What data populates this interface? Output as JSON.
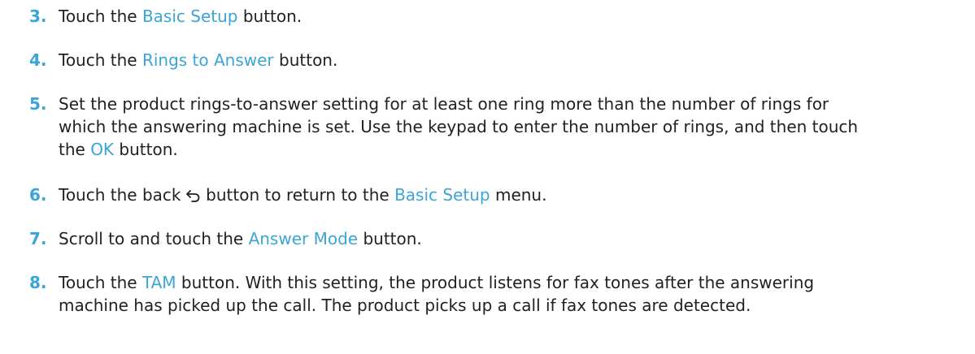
{
  "colors": {
    "accent": "#3aa5d6",
    "text": "#231f20"
  },
  "steps": [
    {
      "number": "3.",
      "parts": [
        "Touch the ",
        "Basic Setup",
        " button."
      ]
    },
    {
      "number": "4.",
      "parts": [
        "Touch the ",
        "Rings to Answer",
        " button."
      ]
    },
    {
      "number": "5.",
      "lines": [
        "Set the product rings-to-answer setting for at least one ring more than the number of rings for",
        "which the answering machine is set. Use the keypad to enter the number of rings, and then touch"
      ],
      "parts": [
        "the ",
        "OK",
        " button."
      ]
    },
    {
      "number": "6.",
      "parts": [
        "Touch the back ",
        "back-arrow-icon",
        " button to return to the ",
        "Basic Setup",
        " menu."
      ]
    },
    {
      "number": "7.",
      "parts": [
        "Scroll to and touch the ",
        "Answer Mode",
        " button."
      ]
    },
    {
      "number": "8.",
      "parts": [
        "Touch the ",
        "TAM",
        " button. With this setting, the product listens for fax tones after the answering"
      ],
      "lines": [
        "machine has picked up the call. The product picks up a call if fax tones are detected."
      ]
    }
  ]
}
